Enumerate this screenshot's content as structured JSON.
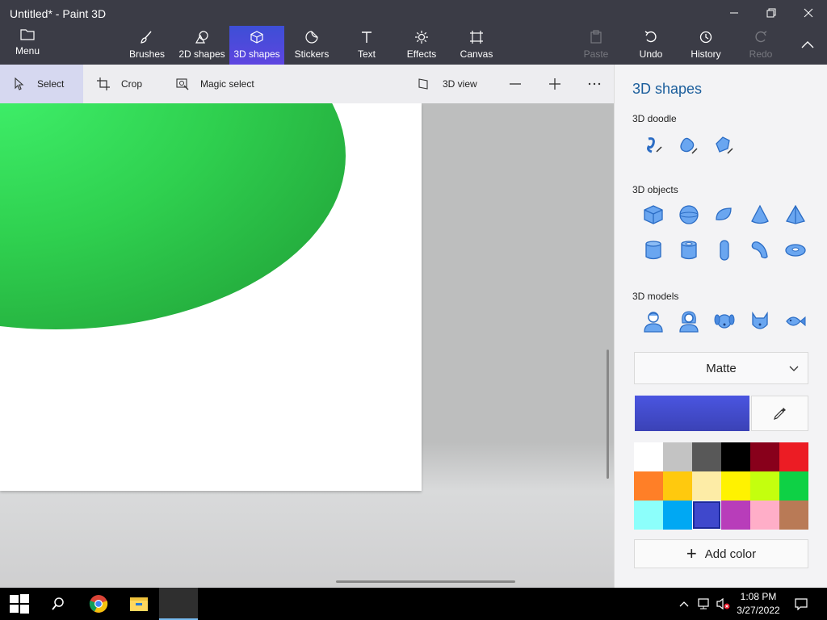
{
  "window": {
    "title": "Untitled* - Paint 3D"
  },
  "toolbar": {
    "menu_label": "Menu",
    "tools": [
      {
        "label": "Brushes"
      },
      {
        "label": "2D shapes"
      },
      {
        "label": "3D shapes"
      },
      {
        "label": "Stickers"
      },
      {
        "label": "Text"
      },
      {
        "label": "Effects"
      },
      {
        "label": "Canvas"
      },
      {
        "label": "Paste"
      },
      {
        "label": "Undo"
      },
      {
        "label": "History"
      },
      {
        "label": "Redo"
      }
    ]
  },
  "subtoolbar": {
    "select": "Select",
    "crop": "Crop",
    "magic_select": "Magic select",
    "view_3d": "3D view"
  },
  "panel": {
    "title": "3D shapes",
    "doodle_label": "3D doodle",
    "objects_label": "3D objects",
    "models_label": "3D models",
    "material": "Matte",
    "add_color": "Add color",
    "current_color": "#4149c9",
    "palette": [
      "#ffffff",
      "#c3c3c3",
      "#585858",
      "#000000",
      "#88001b",
      "#ec1c24",
      "#ff7f27",
      "#ffc90e",
      "#fdeca6",
      "#fff200",
      "#c4ff0e",
      "#0ed145",
      "#8cfffb",
      "#00a8f3",
      "#3f48cc",
      "#b83dba",
      "#ffaec8",
      "#b97a56"
    ]
  },
  "taskbar": {
    "time": "1:08 PM",
    "date": "3/27/2022"
  }
}
